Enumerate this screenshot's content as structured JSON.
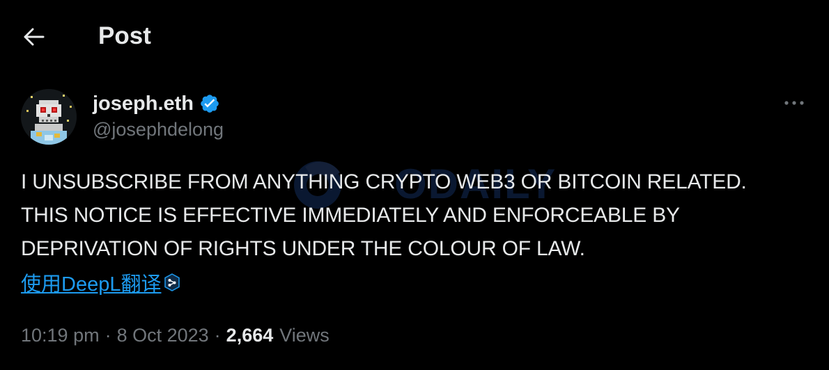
{
  "header": {
    "back_icon": "arrow-left-icon",
    "title": "Post"
  },
  "post": {
    "author": {
      "display_name": "joseph.eth",
      "handle": "@josephdelong",
      "verified": true,
      "verified_color": "#1d9bf0",
      "avatar_icon": "pixel-skull-avatar"
    },
    "more_icon": "more-horizontal-icon",
    "text_lines": [
      "I UNSUBSCRIBE FROM ANYTHING CRYPTO WEB3 OR BITCOIN RELATED.",
      "THIS NOTICE IS EFFECTIVE IMMEDIATELY AND ENFORCEABLE BY",
      "DEPRIVATION OF RIGHTS UNDER THE COLOUR OF LAW."
    ],
    "translate": {
      "label": "使用DeepL翻译",
      "icon": "deepl-icon",
      "color": "#1d9bf0"
    },
    "meta": {
      "time": "10:19 pm",
      "separator": "·",
      "date": "8 Oct 2023",
      "views_count": "2,664",
      "views_label": "Views"
    }
  },
  "watermark": {
    "text": "ODAILY",
    "color": "#2f6fe0"
  },
  "colors": {
    "background": "#000000",
    "primary_text": "#e7e9ea",
    "secondary_text": "#71767b",
    "accent": "#1d9bf0"
  }
}
